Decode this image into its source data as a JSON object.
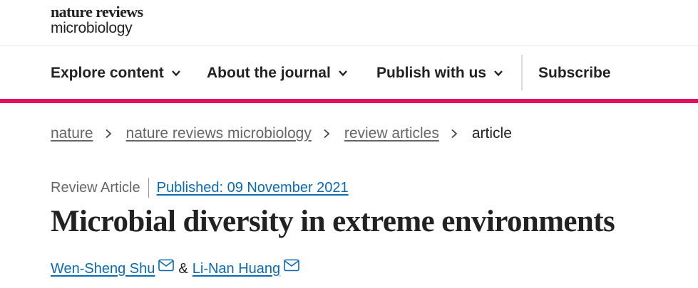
{
  "logo": {
    "line1": "nature reviews",
    "line2": "microbiology"
  },
  "nav": {
    "items": [
      {
        "label": "Explore content",
        "icon": "chevron-down-icon"
      },
      {
        "label": "About the journal",
        "icon": "chevron-down-icon"
      },
      {
        "label": "Publish with us",
        "icon": "chevron-down-icon"
      }
    ],
    "subscribe": "Subscribe"
  },
  "breadcrumb": [
    "nature",
    "nature reviews microbiology",
    "review articles",
    "article"
  ],
  "article": {
    "type": "Review Article",
    "published": "Published: 09 November 2021",
    "title": "Microbial diversity in extreme environments",
    "authors": [
      "Wen-Sheng Shu",
      "Li-Nan Huang"
    ],
    "author_separator": "&"
  },
  "colors": {
    "accent": "#e0115f",
    "link": "#0b6ab2",
    "text": "#222222",
    "muted": "#666666"
  }
}
